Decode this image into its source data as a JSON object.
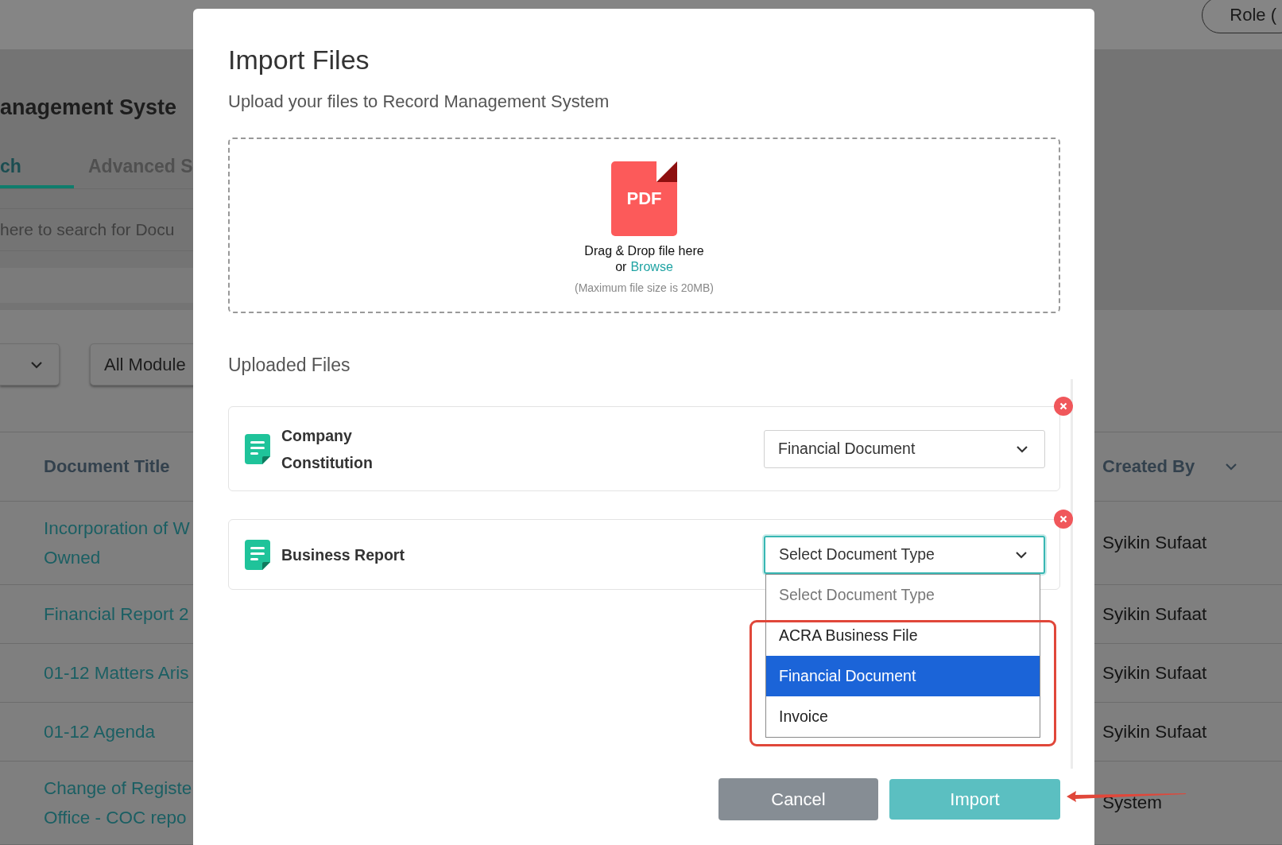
{
  "background": {
    "role_button": "Role (",
    "page_title": "anagement Syste",
    "tabs": [
      {
        "label": "ch",
        "selected": true
      },
      {
        "label": "Advanced S",
        "selected": false
      }
    ],
    "search": {
      "placeholder": "here to search for Docu"
    },
    "filters": [
      {
        "kind": "caret"
      },
      {
        "kind": "text",
        "label": "All Module"
      }
    ],
    "table": {
      "columns": [
        {
          "label": "Document Title",
          "sortable": false
        },
        {
          "label": "Created By",
          "sortable": true
        }
      ],
      "rows": [
        {
          "title_lines": [
            "Incorporation of W",
            "Owned"
          ],
          "created_by": "Syikin Sufaat"
        },
        {
          "title_lines": [
            "Financial Report 2"
          ],
          "created_by": "Syikin Sufaat"
        },
        {
          "title_lines": [
            "01-12 Matters Aris"
          ],
          "created_by": "Syikin Sufaat"
        },
        {
          "title_lines": [
            "01-12 Agenda"
          ],
          "created_by": "Syikin Sufaat"
        },
        {
          "title_lines": [
            "Change of Registe",
            "Office - COC repo"
          ],
          "created_by": "System"
        }
      ]
    }
  },
  "modal": {
    "title": "Import Files",
    "subtitle": "Upload your files to Record Management System",
    "dropzone": {
      "file_icon_label": "PDF",
      "prompt": "Drag & Drop file here",
      "browse_prefix": "or",
      "browse_link": "Browse",
      "note": "(Maximum file size is 20MB)"
    },
    "uploaded_heading": "Uploaded Files",
    "files": [
      {
        "name": "Company Constitution",
        "document_type": "Financial Document",
        "focused": false,
        "open": false
      },
      {
        "name": "Business Report",
        "document_type": "Select Document Type",
        "focused": true,
        "open": true
      }
    ],
    "dropdown_options": [
      {
        "label": "Select Document Type",
        "kind": "placeholder",
        "selected": false
      },
      {
        "label": "ACRA Business File",
        "kind": "option",
        "selected": false
      },
      {
        "label": "Financial Document",
        "kind": "option",
        "selected": true
      },
      {
        "label": "Invoice",
        "kind": "option",
        "selected": false
      }
    ],
    "buttons": [
      {
        "label": "Cancel",
        "kind": "secondary"
      },
      {
        "label": "Import",
        "kind": "primary"
      }
    ]
  },
  "annotations": {
    "highlight_box": true,
    "arrow": true
  }
}
